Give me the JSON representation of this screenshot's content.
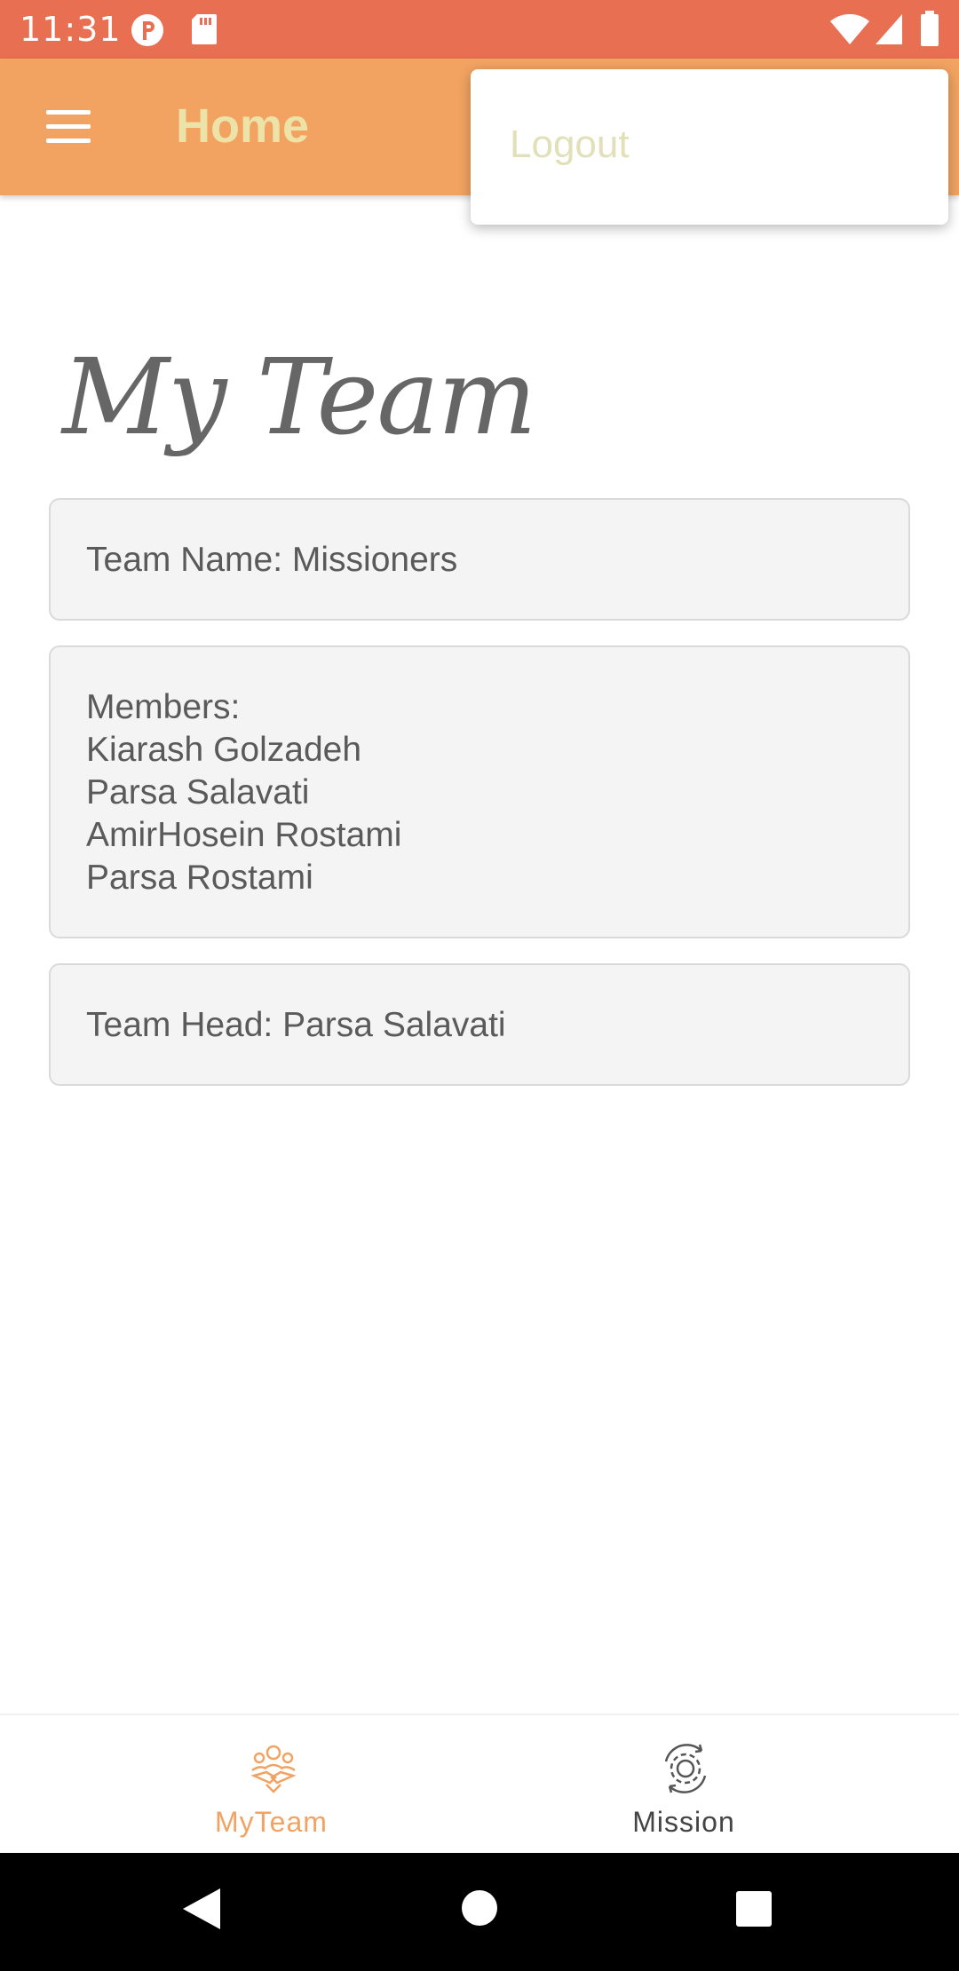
{
  "status_bar": {
    "time": "11:31",
    "icons": [
      "notification-p-icon",
      "sd-card-icon",
      "wifi-icon",
      "signal-icon",
      "battery-icon"
    ]
  },
  "app_bar": {
    "title": "Home",
    "menu_icon": "hamburger-menu-icon"
  },
  "overflow_menu": {
    "items": [
      {
        "label": "Logout"
      }
    ]
  },
  "main": {
    "heading": "My Team",
    "team_name": "Team Name: Missioners",
    "members_label": "Members:",
    "members": [
      "Kiarash Golzadeh",
      "Parsa Salavati",
      "AmirHosein Rostami",
      "Parsa Rostami"
    ],
    "team_head": "Team Head: Parsa Salavati"
  },
  "bottom_nav": {
    "items": [
      {
        "label": "MyTeam",
        "icon": "team-handshake-icon",
        "active": true
      },
      {
        "label": "Mission",
        "icon": "gear-cycle-icon",
        "active": false
      }
    ]
  },
  "system_nav": {
    "buttons": [
      "back-icon",
      "home-icon",
      "recents-icon"
    ]
  },
  "colors": {
    "status_bar": "#E86F52",
    "app_bar": "#F2A362",
    "app_title": "#EBE3A8",
    "popup_text": "#E2E0B8",
    "card_bg": "#F4F4F4",
    "active_nav": "#F2A362"
  }
}
